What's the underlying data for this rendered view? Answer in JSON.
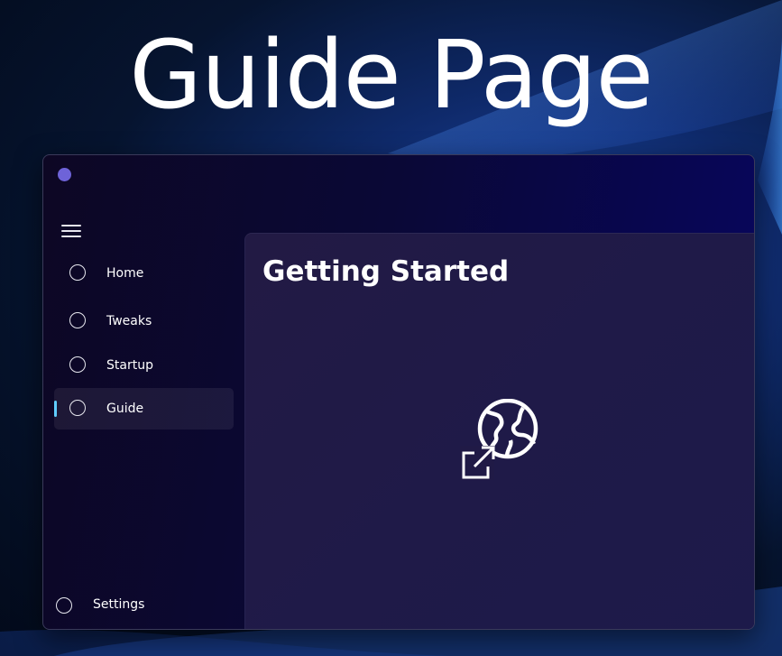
{
  "hero": {
    "title": "Guide Page"
  },
  "window": {
    "app_icon": "app-dot-icon",
    "accent_color": "#6e63d8"
  },
  "nav": {
    "menu_icon": "hamburger-menu-icon",
    "items": [
      {
        "label": "Home",
        "icon": "circle-icon",
        "selected": false
      },
      {
        "label": "Tweaks",
        "icon": "circle-icon",
        "selected": false
      },
      {
        "label": "Startup",
        "icon": "circle-icon",
        "selected": false
      },
      {
        "label": "Guide",
        "icon": "circle-icon",
        "selected": true
      }
    ],
    "selected_indicator_color": "#60cdff",
    "settings": {
      "label": "Settings",
      "icon": "circle-icon"
    }
  },
  "content": {
    "title": "Getting Started",
    "link_icon": "globe-external-link-icon"
  }
}
